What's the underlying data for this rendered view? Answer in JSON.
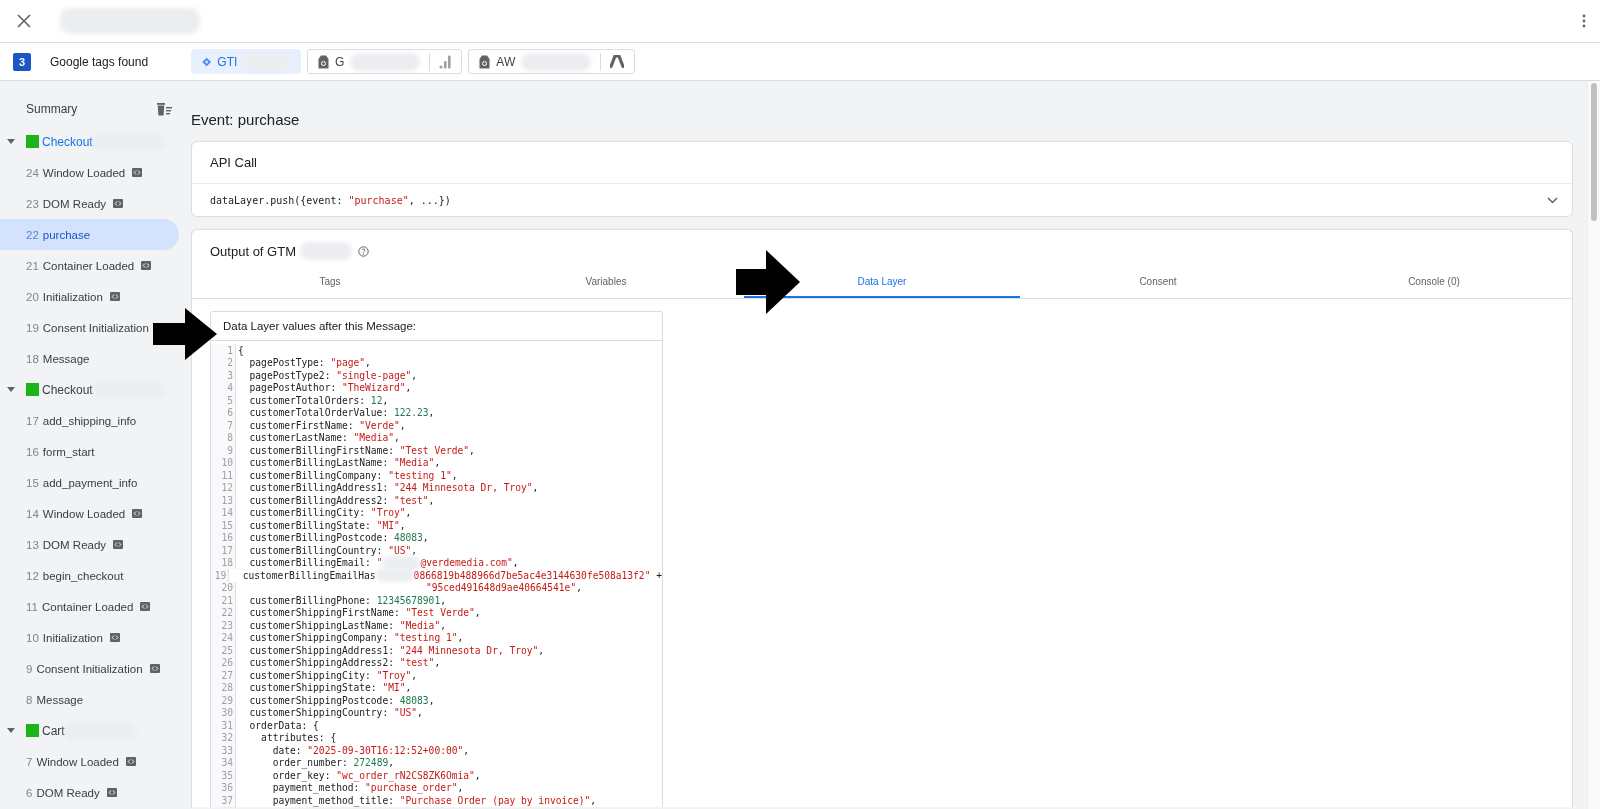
{
  "header": {
    "title_redacted": true
  },
  "tags_bar": {
    "count": "3",
    "label": "Google tags found",
    "chips": [
      {
        "kind": "gtm",
        "label": "GTI",
        "selected": true
      },
      {
        "kind": "ga",
        "label": "G",
        "selected": false
      },
      {
        "kind": "ads",
        "label": "AW",
        "selected": false
      }
    ]
  },
  "sidebar": {
    "summary": "Summary",
    "groups": [
      {
        "title": "Checkout",
        "selected": true,
        "expanded": true,
        "color": "#1db31d",
        "children": [
          {
            "num": "24",
            "label": "Window Loaded",
            "code_icon": true,
            "selected": false
          },
          {
            "num": "23",
            "label": "DOM Ready",
            "code_icon": true,
            "selected": false
          },
          {
            "num": "22",
            "label": "purchase",
            "code_icon": false,
            "selected": true
          },
          {
            "num": "21",
            "label": "Container Loaded",
            "code_icon": true,
            "selected": false
          },
          {
            "num": "20",
            "label": "Initialization",
            "code_icon": true,
            "selected": false
          },
          {
            "num": "19",
            "label": "Consent Initialization",
            "code_icon": false,
            "selected": false
          },
          {
            "num": "18",
            "label": "Message",
            "code_icon": false,
            "selected": false
          }
        ]
      },
      {
        "title": "Checkout",
        "selected": false,
        "expanded": true,
        "color": "#1db31d",
        "children": [
          {
            "num": "17",
            "label": "add_shipping_info",
            "code_icon": false,
            "selected": false
          },
          {
            "num": "16",
            "label": "form_start",
            "code_icon": false,
            "selected": false
          },
          {
            "num": "15",
            "label": "add_payment_info",
            "code_icon": false,
            "selected": false
          },
          {
            "num": "14",
            "label": "Window Loaded",
            "code_icon": true,
            "selected": false
          },
          {
            "num": "13",
            "label": "DOM Ready",
            "code_icon": true,
            "selected": false
          },
          {
            "num": "12",
            "label": "begin_checkout",
            "code_icon": false,
            "selected": false
          },
          {
            "num": "11",
            "label": "Container Loaded",
            "code_icon": true,
            "selected": false
          },
          {
            "num": "10",
            "label": "Initialization",
            "code_icon": true,
            "selected": false
          },
          {
            "num": "9",
            "label": "Consent Initialization",
            "code_icon": true,
            "selected": false
          },
          {
            "num": "8",
            "label": "Message",
            "code_icon": false,
            "selected": false
          }
        ]
      },
      {
        "title": "Cart",
        "selected": false,
        "expanded": true,
        "color": "#1db31d",
        "children": [
          {
            "num": "7",
            "label": "Window Loaded",
            "code_icon": true,
            "selected": false
          },
          {
            "num": "6",
            "label": "DOM Ready",
            "code_icon": true,
            "selected": false
          }
        ]
      }
    ]
  },
  "event": {
    "title": "Event: purchase"
  },
  "api_call": {
    "title": "API Call",
    "code": [
      {
        "kind": "plain",
        "t": "dataLayer.push({event: "
      },
      {
        "kind": "string",
        "t": "\"purchase\""
      },
      {
        "kind": "plain",
        "t": ", ...})"
      }
    ],
    "expanded": false
  },
  "output": {
    "title": "Output of GTM",
    "tabs": [
      {
        "label": "Tags",
        "selected": false
      },
      {
        "label": "Variables",
        "selected": false
      },
      {
        "label": "Data Layer",
        "selected": true
      },
      {
        "label": "Consent",
        "selected": false
      },
      {
        "label": "Console (0)",
        "selected": false
      }
    ]
  },
  "data_layer": {
    "title": "Data Layer values after this Message:",
    "lines": [
      {
        "n": "1",
        "continuation": false,
        "parts": [
          {
            "kind": "plain",
            "t": "{"
          }
        ]
      },
      {
        "n": "2",
        "continuation": false,
        "parts": [
          {
            "kind": "plain",
            "t": "  pagePostType: "
          },
          {
            "kind": "string",
            "t": "\"page\""
          },
          {
            "kind": "plain",
            "t": ","
          }
        ]
      },
      {
        "n": "3",
        "continuation": false,
        "parts": [
          {
            "kind": "plain",
            "t": "  pagePostType2: "
          },
          {
            "kind": "string",
            "t": "\"single-page\""
          },
          {
            "kind": "plain",
            "t": ","
          }
        ]
      },
      {
        "n": "4",
        "continuation": false,
        "parts": [
          {
            "kind": "plain",
            "t": "  pagePostAuthor: "
          },
          {
            "kind": "string",
            "t": "\"TheWizard\""
          },
          {
            "kind": "plain",
            "t": ","
          }
        ]
      },
      {
        "n": "5",
        "continuation": false,
        "parts": [
          {
            "kind": "plain",
            "t": "  customerTotalOrders: "
          },
          {
            "kind": "number",
            "t": "12"
          },
          {
            "kind": "plain",
            "t": ","
          }
        ]
      },
      {
        "n": "6",
        "continuation": false,
        "parts": [
          {
            "kind": "plain",
            "t": "  customerTotalOrderValue: "
          },
          {
            "kind": "number",
            "t": "122.23"
          },
          {
            "kind": "plain",
            "t": ","
          }
        ]
      },
      {
        "n": "7",
        "continuation": false,
        "parts": [
          {
            "kind": "plain",
            "t": "  customerFirstName: "
          },
          {
            "kind": "string",
            "t": "\"Verde\""
          },
          {
            "kind": "plain",
            "t": ","
          }
        ]
      },
      {
        "n": "8",
        "continuation": false,
        "parts": [
          {
            "kind": "plain",
            "t": "  customerLastName: "
          },
          {
            "kind": "string",
            "t": "\"Media\""
          },
          {
            "kind": "plain",
            "t": ","
          }
        ]
      },
      {
        "n": "9",
        "continuation": false,
        "parts": [
          {
            "kind": "plain",
            "t": "  customerBillingFirstName: "
          },
          {
            "kind": "string",
            "t": "\"Test Verde\""
          },
          {
            "kind": "plain",
            "t": ","
          }
        ]
      },
      {
        "n": "10",
        "continuation": false,
        "parts": [
          {
            "kind": "plain",
            "t": "  customerBillingLastName: "
          },
          {
            "kind": "string",
            "t": "\"Media\""
          },
          {
            "kind": "plain",
            "t": ","
          }
        ]
      },
      {
        "n": "11",
        "continuation": false,
        "parts": [
          {
            "kind": "plain",
            "t": "  customerBillingCompany: "
          },
          {
            "kind": "string",
            "t": "\"testing 1\""
          },
          {
            "kind": "plain",
            "t": ","
          }
        ]
      },
      {
        "n": "12",
        "continuation": false,
        "parts": [
          {
            "kind": "plain",
            "t": "  customerBillingAddress1: "
          },
          {
            "kind": "string",
            "t": "\"244 Minnesota Dr, Troy\""
          },
          {
            "kind": "plain",
            "t": ","
          }
        ]
      },
      {
        "n": "13",
        "continuation": false,
        "parts": [
          {
            "kind": "plain",
            "t": "  customerBillingAddress2: "
          },
          {
            "kind": "string",
            "t": "\"test\""
          },
          {
            "kind": "plain",
            "t": ","
          }
        ]
      },
      {
        "n": "14",
        "continuation": false,
        "parts": [
          {
            "kind": "plain",
            "t": "  customerBillingCity: "
          },
          {
            "kind": "string",
            "t": "\"Troy\""
          },
          {
            "kind": "plain",
            "t": ","
          }
        ]
      },
      {
        "n": "15",
        "continuation": false,
        "parts": [
          {
            "kind": "plain",
            "t": "  customerBillingState: "
          },
          {
            "kind": "string",
            "t": "\"MI\""
          },
          {
            "kind": "plain",
            "t": ","
          }
        ]
      },
      {
        "n": "16",
        "continuation": false,
        "parts": [
          {
            "kind": "plain",
            "t": "  customerBillingPostcode: "
          },
          {
            "kind": "number",
            "t": "48083"
          },
          {
            "kind": "plain",
            "t": ","
          }
        ]
      },
      {
        "n": "17",
        "continuation": false,
        "parts": [
          {
            "kind": "plain",
            "t": "  customerBillingCountry: "
          },
          {
            "kind": "string",
            "t": "\"US\""
          },
          {
            "kind": "plain",
            "t": ","
          }
        ]
      },
      {
        "n": "18",
        "continuation": false,
        "parts": [
          {
            "kind": "plain",
            "t": "  customerBillingEmail: "
          },
          {
            "kind": "string",
            "t": "\""
          },
          {
            "kind": "redacted"
          },
          {
            "kind": "string",
            "t": "@verdemedia.com\""
          },
          {
            "kind": "plain",
            "t": ","
          }
        ]
      },
      {
        "n": "19",
        "continuation": false,
        "parts": [
          {
            "kind": "plain",
            "t": "  customerBillingEmailHas"
          },
          {
            "kind": "redacted"
          },
          {
            "kind": "string",
            "t": "0866819b488966d7be5ac4e3144630fe508a13f2\""
          },
          {
            "kind": "plain",
            "t": " +"
          }
        ]
      },
      {
        "n": "20",
        "continuation": true,
        "parts": [
          {
            "kind": "string",
            "t": "\"95ced491648d9ae40664541e\""
          },
          {
            "kind": "plain",
            "t": ","
          }
        ]
      },
      {
        "n": "21",
        "continuation": false,
        "parts": [
          {
            "kind": "plain",
            "t": "  customerBillingPhone: "
          },
          {
            "kind": "number",
            "t": "12345678901"
          },
          {
            "kind": "plain",
            "t": ","
          }
        ]
      },
      {
        "n": "22",
        "continuation": false,
        "parts": [
          {
            "kind": "plain",
            "t": "  customerShippingFirstName: "
          },
          {
            "kind": "string",
            "t": "\"Test Verde\""
          },
          {
            "kind": "plain",
            "t": ","
          }
        ]
      },
      {
        "n": "23",
        "continuation": false,
        "parts": [
          {
            "kind": "plain",
            "t": "  customerShippingLastName: "
          },
          {
            "kind": "string",
            "t": "\"Media\""
          },
          {
            "kind": "plain",
            "t": ","
          }
        ]
      },
      {
        "n": "24",
        "continuation": false,
        "parts": [
          {
            "kind": "plain",
            "t": "  customerShippingCompany: "
          },
          {
            "kind": "string",
            "t": "\"testing 1\""
          },
          {
            "kind": "plain",
            "t": ","
          }
        ]
      },
      {
        "n": "25",
        "continuation": false,
        "parts": [
          {
            "kind": "plain",
            "t": "  customerShippingAddress1: "
          },
          {
            "kind": "string",
            "t": "\"244 Minnesota Dr, Troy\""
          },
          {
            "kind": "plain",
            "t": ","
          }
        ]
      },
      {
        "n": "26",
        "continuation": false,
        "parts": [
          {
            "kind": "plain",
            "t": "  customerShippingAddress2: "
          },
          {
            "kind": "string",
            "t": "\"test\""
          },
          {
            "kind": "plain",
            "t": ","
          }
        ]
      },
      {
        "n": "27",
        "continuation": false,
        "parts": [
          {
            "kind": "plain",
            "t": "  customerShippingCity: "
          },
          {
            "kind": "string",
            "t": "\"Troy\""
          },
          {
            "kind": "plain",
            "t": ","
          }
        ]
      },
      {
        "n": "28",
        "continuation": false,
        "parts": [
          {
            "kind": "plain",
            "t": "  customerShippingState: "
          },
          {
            "kind": "string",
            "t": "\"MI\""
          },
          {
            "kind": "plain",
            "t": ","
          }
        ]
      },
      {
        "n": "29",
        "continuation": false,
        "parts": [
          {
            "kind": "plain",
            "t": "  customerShippingPostcode: "
          },
          {
            "kind": "number",
            "t": "48083"
          },
          {
            "kind": "plain",
            "t": ","
          }
        ]
      },
      {
        "n": "30",
        "continuation": false,
        "parts": [
          {
            "kind": "plain",
            "t": "  customerShippingCountry: "
          },
          {
            "kind": "string",
            "t": "\"US\""
          },
          {
            "kind": "plain",
            "t": ","
          }
        ]
      },
      {
        "n": "31",
        "continuation": false,
        "parts": [
          {
            "kind": "plain",
            "t": "  orderData: {"
          }
        ]
      },
      {
        "n": "32",
        "continuation": false,
        "parts": [
          {
            "kind": "plain",
            "t": "    attributes: {"
          }
        ]
      },
      {
        "n": "33",
        "continuation": false,
        "parts": [
          {
            "kind": "plain",
            "t": "      date: "
          },
          {
            "kind": "string",
            "t": "\"2025-09-30T16:12:52+00:00\""
          },
          {
            "kind": "plain",
            "t": ","
          }
        ]
      },
      {
        "n": "34",
        "continuation": false,
        "parts": [
          {
            "kind": "plain",
            "t": "      order_number: "
          },
          {
            "kind": "number",
            "t": "272489"
          },
          {
            "kind": "plain",
            "t": ","
          }
        ]
      },
      {
        "n": "35",
        "continuation": false,
        "parts": [
          {
            "kind": "plain",
            "t": "      order_key: "
          },
          {
            "kind": "string",
            "t": "\"wc_order_rN2CS8ZK6Omia\""
          },
          {
            "kind": "plain",
            "t": ","
          }
        ]
      },
      {
        "n": "36",
        "continuation": false,
        "parts": [
          {
            "kind": "plain",
            "t": "      payment_method: "
          },
          {
            "kind": "string",
            "t": "\"purchase_order\""
          },
          {
            "kind": "plain",
            "t": ","
          }
        ]
      },
      {
        "n": "37",
        "continuation": false,
        "parts": [
          {
            "kind": "plain",
            "t": "      payment_method_title: "
          },
          {
            "kind": "string",
            "t": "\"Purchase Order (pay by invoice)\""
          },
          {
            "kind": "plain",
            "t": ","
          }
        ]
      }
    ]
  }
}
